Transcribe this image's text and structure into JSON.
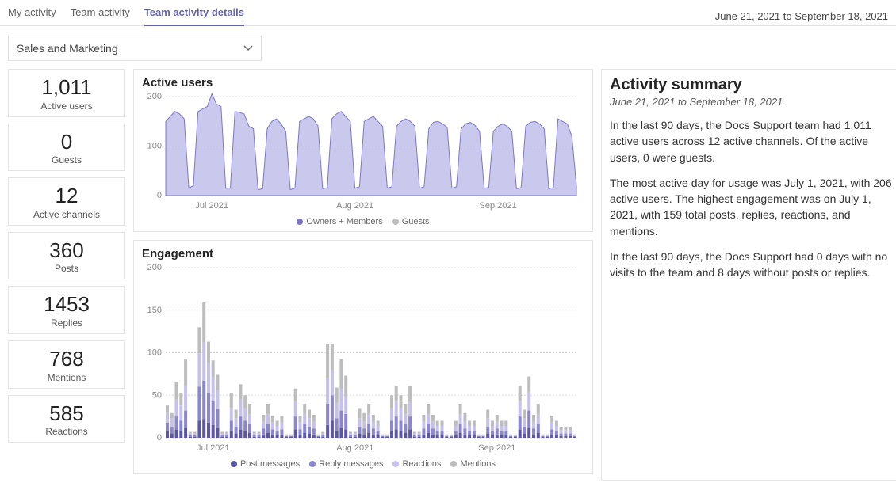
{
  "tabs": {
    "my": "My activity",
    "team": "Team activity",
    "details": "Team activity details"
  },
  "date_range": "June 21, 2021 to September 18, 2021",
  "team_select": {
    "value": "Sales and Marketing"
  },
  "cards": [
    {
      "value": "1,011",
      "label": "Active users"
    },
    {
      "value": "0",
      "label": "Guests"
    },
    {
      "value": "12",
      "label": "Active channels"
    },
    {
      "value": "360",
      "label": "Posts"
    },
    {
      "value": "1453",
      "label": "Replies"
    },
    {
      "value": "768",
      "label": "Mentions"
    },
    {
      "value": "585",
      "label": "Reactions"
    }
  ],
  "active_users": {
    "title": "Active users",
    "legend": [
      "Owners + Members",
      "Guests"
    ],
    "colors": {
      "members": "#7b77c7",
      "guests": "#bdbdbd"
    }
  },
  "engagement": {
    "title": "Engagement",
    "legend": [
      "Post messages",
      "Reply messages",
      "Reactions",
      "Mentions"
    ],
    "colors": {
      "post": "#5b57a6",
      "reply": "#8a86d0",
      "react": "#c5c1ec",
      "ment": "#bdbdbd"
    }
  },
  "summary": {
    "title": "Activity summary",
    "subtitle": "June 21, 2021 to September 18, 2021",
    "p1": "In the last 90 days, the Docs Support team had 1,011 active users across 12 active channels. Of the active users, 0 were guests.",
    "p2": "The most active day for usage was July 1, 2021, with 206 active users. The highest engagement was on July 1, 2021, with 159 total posts, replies, reactions, and mentions.",
    "p3": "In the last 90 days, the Docs Support had 0 days with no visits to the team and 8 days without posts or replies."
  },
  "chart_data": [
    {
      "type": "area",
      "title": "Active users",
      "ylabel": "",
      "xlabel": "",
      "ylim": [
        0,
        200
      ],
      "y_ticks": [
        0,
        100,
        200
      ],
      "x_tick_labels": [
        "Jul 2021",
        "Aug 2021",
        "Sep 2021"
      ],
      "note": "90 daily points, June 21 – September 18, 2021. Guests series is constant 0.",
      "series": [
        {
          "name": "Owners + Members",
          "color": "#7b77c7",
          "values": [
            150,
            160,
            170,
            165,
            155,
            15,
            20,
            170,
            175,
            180,
            206,
            185,
            180,
            15,
            15,
            170,
            168,
            165,
            140,
            135,
            12,
            14,
            135,
            150,
            155,
            145,
            130,
            12,
            15,
            150,
            155,
            160,
            155,
            140,
            14,
            16,
            155,
            165,
            170,
            160,
            150,
            15,
            18,
            150,
            155,
            160,
            150,
            140,
            15,
            18,
            140,
            150,
            155,
            150,
            140,
            15,
            18,
            135,
            148,
            150,
            145,
            138,
            15,
            18,
            135,
            145,
            148,
            142,
            130,
            15,
            16,
            130,
            140,
            145,
            140,
            130,
            14,
            16,
            140,
            148,
            150,
            145,
            135,
            14,
            16,
            155,
            150,
            145,
            120,
            20
          ]
        },
        {
          "name": "Guests",
          "color": "#bdbdbd",
          "values": [
            0,
            0,
            0,
            0,
            0,
            0,
            0,
            0,
            0,
            0,
            0,
            0,
            0,
            0,
            0,
            0,
            0,
            0,
            0,
            0,
            0,
            0,
            0,
            0,
            0,
            0,
            0,
            0,
            0,
            0,
            0,
            0,
            0,
            0,
            0,
            0,
            0,
            0,
            0,
            0,
            0,
            0,
            0,
            0,
            0,
            0,
            0,
            0,
            0,
            0,
            0,
            0,
            0,
            0,
            0,
            0,
            0,
            0,
            0,
            0,
            0,
            0,
            0,
            0,
            0,
            0,
            0,
            0,
            0,
            0,
            0,
            0,
            0,
            0,
            0,
            0,
            0,
            0,
            0,
            0,
            0,
            0,
            0,
            0,
            0,
            0,
            0,
            0,
            0,
            0
          ]
        }
      ]
    },
    {
      "type": "bar",
      "stacked": true,
      "title": "Engagement",
      "ylabel": "",
      "xlabel": "",
      "ylim": [
        0,
        200
      ],
      "y_ticks": [
        0,
        50,
        100,
        150,
        200
      ],
      "x_tick_labels": [
        "Jul 2021",
        "Aug 2021",
        "Sep 2021"
      ],
      "note": "Stacked daily totals of posts, replies, reactions, mentions over 90 days. Values estimated from chart.",
      "series_names": [
        "Post messages",
        "Reply messages",
        "Reactions",
        "Mentions"
      ],
      "series_colors": [
        "#5b57a6",
        "#8a86d0",
        "#c5c1ec",
        "#bdbdbd"
      ],
      "stacks": [
        [
          8,
          10,
          12,
          8
        ],
        [
          5,
          8,
          10,
          6
        ],
        [
          10,
          15,
          20,
          20
        ],
        [
          8,
          12,
          18,
          15
        ],
        [
          12,
          20,
          30,
          30
        ],
        [
          1,
          2,
          2,
          2
        ],
        [
          1,
          2,
          2,
          2
        ],
        [
          20,
          40,
          40,
          30
        ],
        [
          22,
          45,
          45,
          47
        ],
        [
          18,
          35,
          35,
          25
        ],
        [
          15,
          28,
          28,
          20
        ],
        [
          12,
          22,
          22,
          18
        ],
        [
          1,
          2,
          2,
          2
        ],
        [
          1,
          2,
          2,
          2
        ],
        [
          8,
          12,
          15,
          18
        ],
        [
          5,
          8,
          10,
          10
        ],
        [
          10,
          15,
          20,
          18
        ],
        [
          8,
          12,
          15,
          15
        ],
        [
          6,
          10,
          12,
          12
        ],
        [
          1,
          2,
          2,
          2
        ],
        [
          1,
          2,
          2,
          2
        ],
        [
          4,
          7,
          8,
          8
        ],
        [
          6,
          10,
          12,
          12
        ],
        [
          4,
          6,
          8,
          8
        ],
        [
          3,
          5,
          6,
          6
        ],
        [
          4,
          6,
          8,
          8
        ],
        [
          1,
          1,
          1,
          1
        ],
        [
          1,
          1,
          1,
          1
        ],
        [
          10,
          15,
          18,
          15
        ],
        [
          4,
          6,
          8,
          8
        ],
        [
          6,
          10,
          12,
          12
        ],
        [
          5,
          8,
          10,
          10
        ],
        [
          4,
          7,
          8,
          8
        ],
        [
          1,
          1,
          1,
          1
        ],
        [
          1,
          2,
          2,
          2
        ],
        [
          15,
          25,
          30,
          40
        ],
        [
          20,
          30,
          30,
          30
        ],
        [
          8,
          15,
          18,
          18
        ],
        [
          12,
          20,
          25,
          35
        ],
        [
          10,
          18,
          20,
          25
        ],
        [
          1,
          2,
          2,
          2
        ],
        [
          1,
          2,
          2,
          2
        ],
        [
          5,
          8,
          10,
          12
        ],
        [
          4,
          7,
          8,
          10
        ],
        [
          6,
          10,
          12,
          12
        ],
        [
          4,
          7,
          8,
          8
        ],
        [
          3,
          5,
          6,
          6
        ],
        [
          1,
          1,
          1,
          1
        ],
        [
          1,
          1,
          1,
          1
        ],
        [
          8,
          12,
          15,
          15
        ],
        [
          10,
          15,
          18,
          18
        ],
        [
          8,
          12,
          15,
          15
        ],
        [
          6,
          10,
          12,
          12
        ],
        [
          10,
          15,
          18,
          18
        ],
        [
          1,
          2,
          2,
          2
        ],
        [
          1,
          2,
          2,
          2
        ],
        [
          4,
          7,
          8,
          8
        ],
        [
          6,
          10,
          12,
          12
        ],
        [
          4,
          7,
          8,
          8
        ],
        [
          3,
          5,
          6,
          6
        ],
        [
          3,
          5,
          6,
          6
        ],
        [
          1,
          1,
          1,
          1
        ],
        [
          1,
          1,
          1,
          1
        ],
        [
          3,
          5,
          6,
          6
        ],
        [
          6,
          10,
          12,
          12
        ],
        [
          4,
          7,
          8,
          10
        ],
        [
          3,
          5,
          6,
          6
        ],
        [
          3,
          5,
          6,
          6
        ],
        [
          1,
          1,
          1,
          1
        ],
        [
          1,
          1,
          1,
          1
        ],
        [
          5,
          8,
          10,
          10
        ],
        [
          3,
          5,
          6,
          6
        ],
        [
          4,
          7,
          8,
          8
        ],
        [
          3,
          5,
          6,
          6
        ],
        [
          3,
          5,
          6,
          6
        ],
        [
          1,
          1,
          1,
          1
        ],
        [
          1,
          1,
          1,
          1
        ],
        [
          10,
          15,
          18,
          18
        ],
        [
          5,
          8,
          10,
          10
        ],
        [
          12,
          20,
          22,
          18
        ],
        [
          4,
          7,
          8,
          8
        ],
        [
          6,
          10,
          12,
          12
        ],
        [
          1,
          1,
          1,
          1
        ],
        [
          1,
          1,
          1,
          1
        ],
        [
          4,
          6,
          8,
          8
        ],
        [
          3,
          5,
          6,
          6
        ],
        [
          2,
          3,
          4,
          4
        ],
        [
          2,
          3,
          4,
          4
        ],
        [
          2,
          3,
          4,
          4
        ],
        [
          1,
          1,
          1,
          1
        ]
      ]
    }
  ]
}
